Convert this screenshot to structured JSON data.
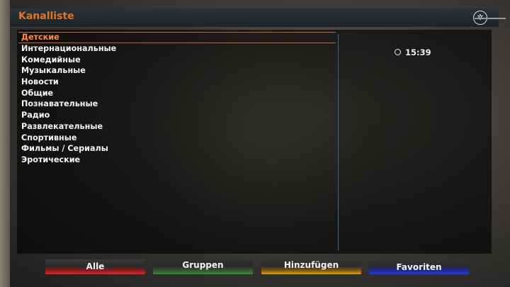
{
  "window": {
    "title": "Kanalliste"
  },
  "groups": [
    "Детские",
    "Интернациональные",
    "Комедийные",
    "Музыкальные",
    "Новости",
    "Общие",
    "Познавательные",
    "Радио",
    "Развлекательные",
    "Спортивные",
    "Фильмы / Сериалы",
    "Эротические"
  ],
  "selected_index": 0,
  "clock": {
    "time": "15:39",
    "icon": "clock-icon"
  },
  "buttons": {
    "red": {
      "label": "Alle",
      "color": "#e0262a"
    },
    "green": {
      "label": "Gruppen",
      "color": "#3a8a36"
    },
    "yellow": {
      "label": "Hinzufügen",
      "color": "#e0a010"
    },
    "blue": {
      "label": "Favoriten",
      "color": "#1f3ee0"
    }
  },
  "colors": {
    "accent": "#e0762a",
    "divider": "#2f6a88"
  }
}
